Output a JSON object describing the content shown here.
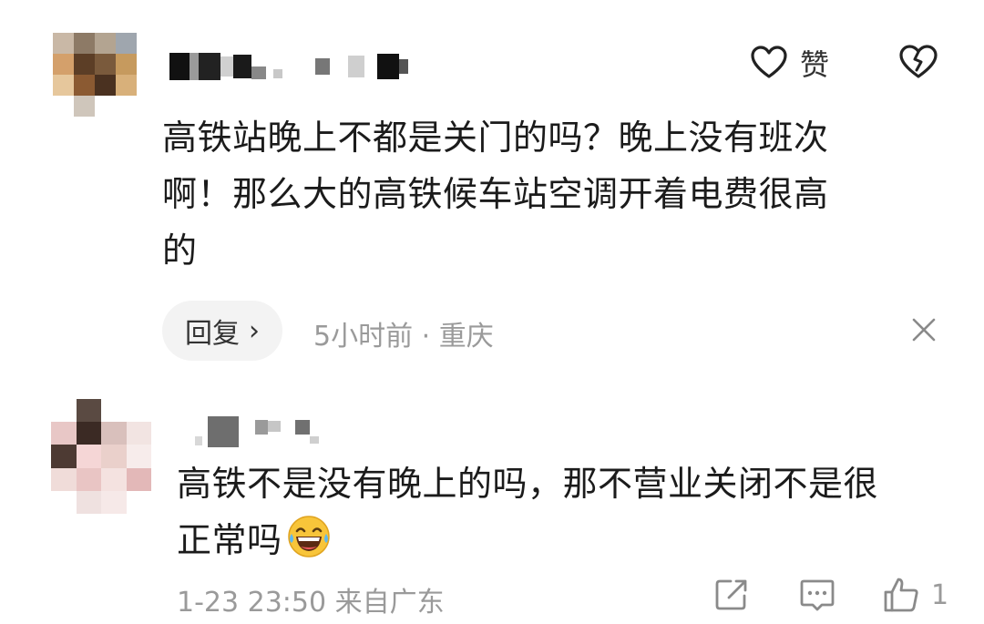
{
  "comments": [
    {
      "text_line1": "高铁站晚上不都是关门的吗？晚上没有班次",
      "text_line2": "啊！那么大的高铁候车站空调开着电费很高",
      "text_line3": "的",
      "like_label": "赞",
      "reply_label": "回复",
      "reply_chevron": "›",
      "meta": "5小时前 · 重庆",
      "icons": [
        "heart-outline-icon",
        "broken-heart-icon",
        "close-icon"
      ]
    },
    {
      "text_line1": "高铁不是没有晚上的吗，那不营业关闭不是很",
      "text_line2": "正常吗",
      "emoji": "laughing-crying-emoji",
      "meta": "1-23 23:50 来自广东",
      "like_count": "1",
      "icons": [
        "share-icon",
        "comment-icon",
        "thumbs-up-icon"
      ]
    }
  ],
  "colors": {
    "text": "#1b1b1b",
    "meta": "#9a9a9a",
    "reply_bg": "#f3f3f3"
  }
}
